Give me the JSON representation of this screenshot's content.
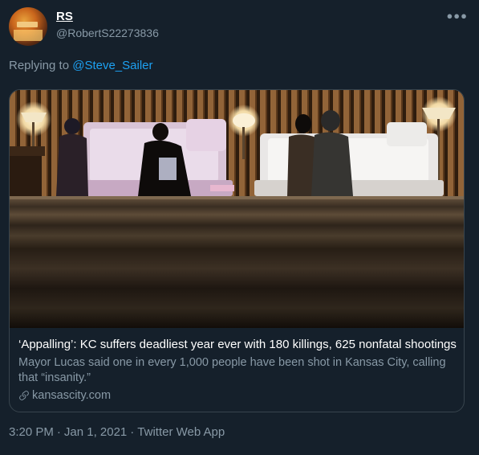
{
  "author": {
    "display_name": "RS",
    "handle": "@RobertS22273836",
    "avatar_icon": "avatar-photo"
  },
  "more_icon": "more-horizontal-icon",
  "reply": {
    "prefix": "Replying to",
    "mention": "@Steve_Sailer"
  },
  "card": {
    "title": "‘Appalling’: KC suffers deadliest year ever with 180 killings, 625 nonfatal shootings",
    "description": "Mayor Lucas said one in every 1,000 people have been shot in Kansas City, calling that “insanity.”",
    "domain": "kansascity.com",
    "domain_icon": "link-icon"
  },
  "meta": {
    "time": "3:20 PM",
    "separator": "·",
    "date": "Jan 1, 2021",
    "source": "Twitter Web App"
  },
  "colors": {
    "background": "#15202b",
    "secondary_text": "#8899a6",
    "link": "#1da1f2",
    "border": "#38444d"
  }
}
